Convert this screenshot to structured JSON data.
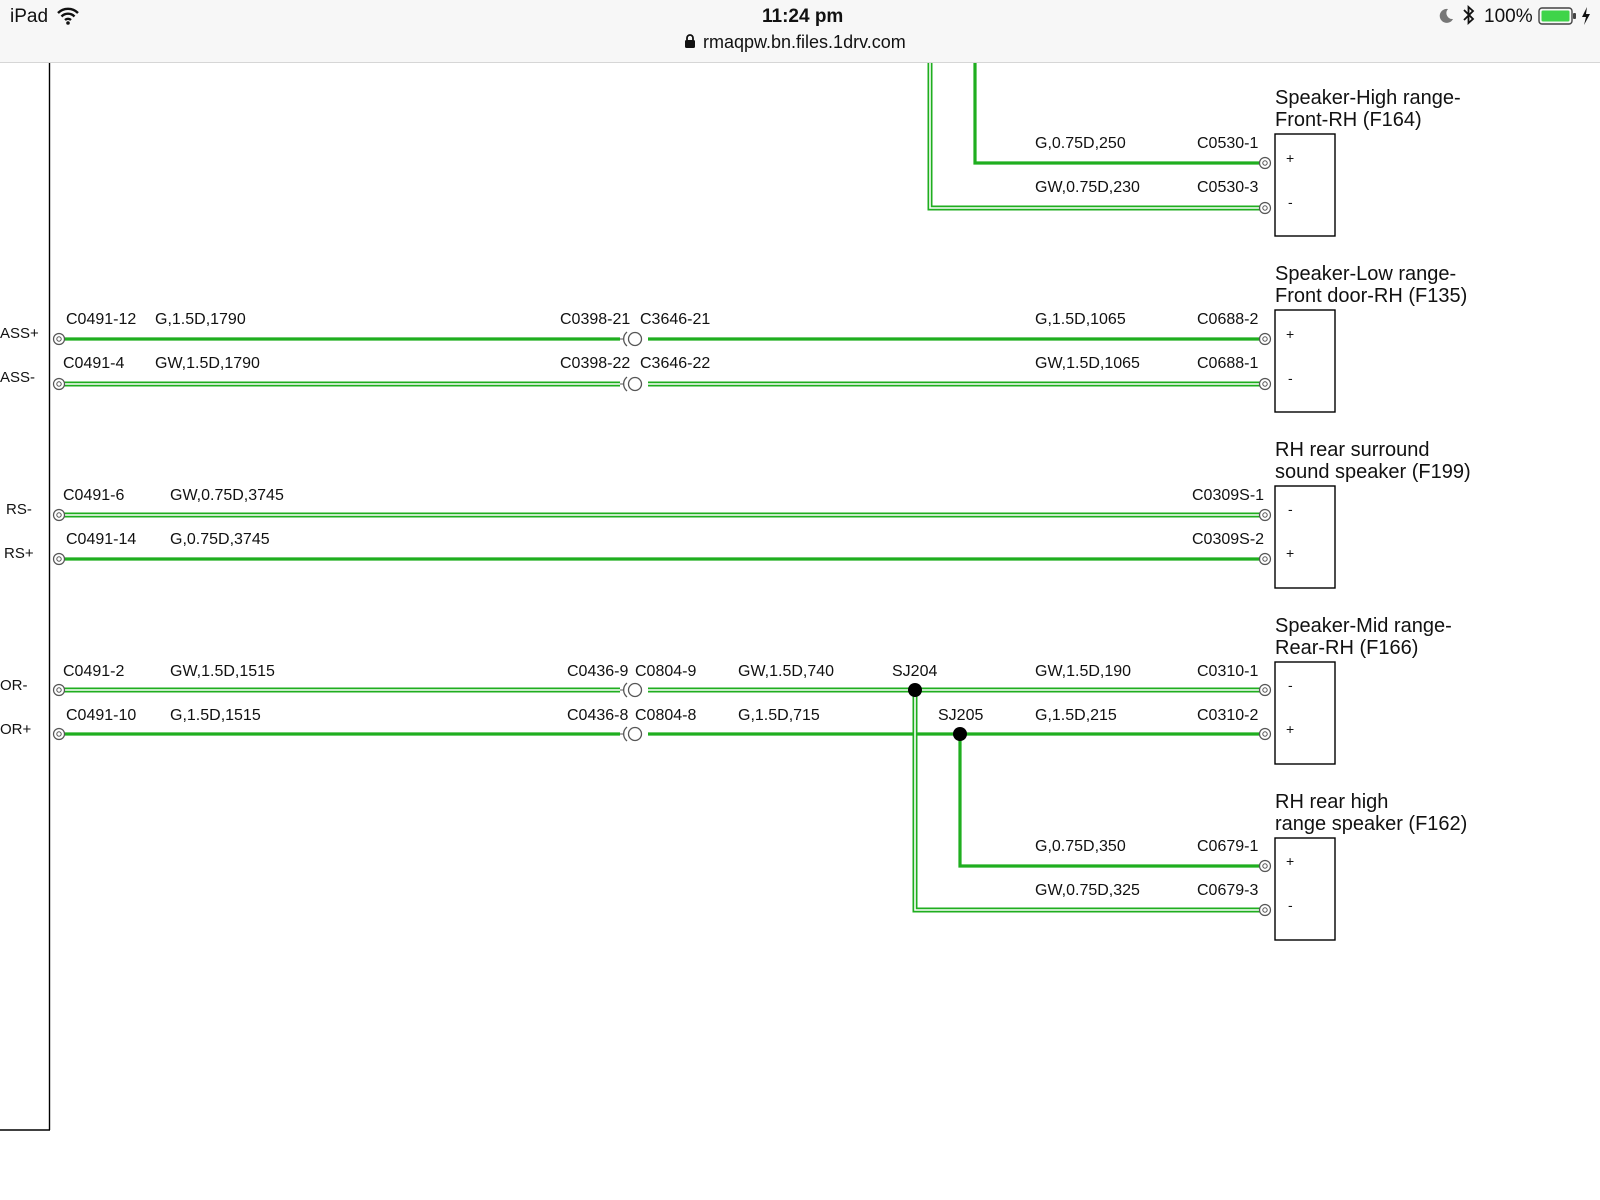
{
  "status_bar": {
    "device": "iPad",
    "time": "11:24 pm",
    "url": "rmaqpw.bn.files.1drv.com",
    "battery": "100%",
    "icons": [
      "wifi-icon",
      "lock-icon",
      "moon-icon",
      "bluetooth-icon",
      "battery-icon",
      "charging-icon"
    ]
  },
  "colors": {
    "wire_green": "#1fae1f",
    "junction": "#000000",
    "frame": "#000000"
  },
  "left_labels": {
    "bass_plus": "ASS+",
    "bass_minus": "ASS-",
    "rs_minus": "RS-",
    "rs_plus": "RS+",
    "or_minus": "OR-",
    "or_plus": "OR+"
  },
  "speakers": {
    "f164": {
      "line1": "Speaker-High range-",
      "line2": "Front-RH (F164)",
      "pin_top": "+",
      "pin_bottom": "-"
    },
    "f135": {
      "line1": "Speaker-Low range-",
      "line2": "Front door-RH (F135)",
      "pin_top": "+",
      "pin_bottom": "-"
    },
    "f199": {
      "line1": "RH rear surround",
      "line2": "sound speaker (F199)",
      "pin_top": "-",
      "pin_bottom": "+"
    },
    "f166": {
      "line1": "Speaker-Mid range-",
      "line2": "Rear-RH (F166)",
      "pin_top": "-",
      "pin_bottom": "+"
    },
    "f162": {
      "line1": "RH rear high",
      "line2": "range speaker (F162)",
      "pin_top": "+",
      "pin_bottom": "-"
    }
  },
  "wire_labels": {
    "f164_top_spec": "G,0.75D,250",
    "f164_top_conn": "C0530-1",
    "f164_bot_spec": "GW,0.75D,230",
    "f164_bot_conn": "C0530-3",
    "bass_top_c1": "C0491-12",
    "bass_top_spec1": "G,1.5D,1790",
    "bass_top_c2": "C0398-21",
    "bass_top_c3": "C3646-21",
    "bass_top_spec2": "G,1.5D,1065",
    "bass_top_c4": "C0688-2",
    "bass_bot_c1": "C0491-4",
    "bass_bot_spec1": "GW,1.5D,1790",
    "bass_bot_c2": "C0398-22",
    "bass_bot_c3": "C3646-22",
    "bass_bot_spec2": "GW,1.5D,1065",
    "bass_bot_c4": "C0688-1",
    "rs_top_c1": "C0491-6",
    "rs_top_spec": "GW,0.75D,3745",
    "rs_top_c2": "C0309S-1",
    "rs_bot_c1": "C0491-14",
    "rs_bot_spec": "G,0.75D,3745",
    "rs_bot_c2": "C0309S-2",
    "or_top_c1": "C0491-2",
    "or_top_spec1": "GW,1.5D,1515",
    "or_top_c2": "C0436-9",
    "or_top_c3": "C0804-9",
    "or_top_spec2": "GW,1.5D,740",
    "sj204": "SJ204",
    "or_top_spec3": "GW,1.5D,190",
    "or_top_c4": "C0310-1",
    "or_bot_c1": "C0491-10",
    "or_bot_spec1": "G,1.5D,1515",
    "or_bot_c2": "C0436-8",
    "or_bot_c3": "C0804-8",
    "or_bot_spec2": "G,1.5D,715",
    "sj205": "SJ205",
    "or_bot_spec3": "G,1.5D,215",
    "or_bot_c4": "C0310-2",
    "f162_top_spec": "G,0.75D,350",
    "f162_top_conn": "C0679-1",
    "f162_bot_spec": "GW,0.75D,325",
    "f162_bot_conn": "C0679-3"
  }
}
